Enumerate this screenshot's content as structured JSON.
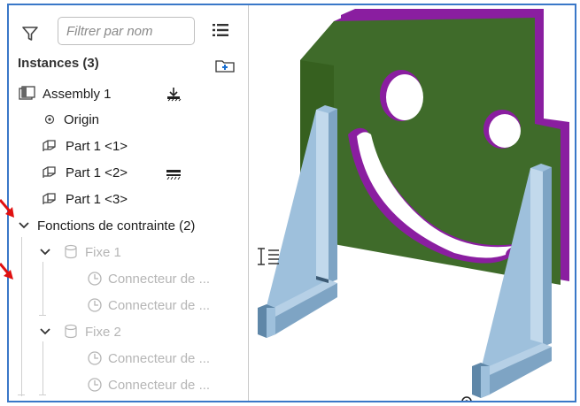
{
  "search": {
    "placeholder": "Filtrer par nom"
  },
  "instances_header": "Instances (3)",
  "tree": {
    "assembly": "Assembly 1",
    "origin": "Origin",
    "parts": [
      "Part 1 <1>",
      "Part 1 <2>",
      "Part 1 <3>"
    ],
    "mate_features": "Fonctions de contrainte (2)",
    "fixe1": "Fixe 1",
    "fixe2": "Fixe 2",
    "connector": "Connecteur de ..."
  },
  "colors": {
    "panel_border": "#3a78c8",
    "plate": "#3f6b2a",
    "plate_edge": "#8a1ea0",
    "stand": "#9ec0dc",
    "stand_dark": "#3c5a74",
    "arrow": "#e01010"
  },
  "icons": [
    "filter-icon",
    "list-view-icon",
    "new-folder-icon",
    "assembly-icon",
    "origin-icon",
    "part-icon",
    "chevron-down-icon",
    "fixed-mate-icon",
    "mate-connector-icon",
    "insert-icon",
    "toggle-list-icon"
  ]
}
